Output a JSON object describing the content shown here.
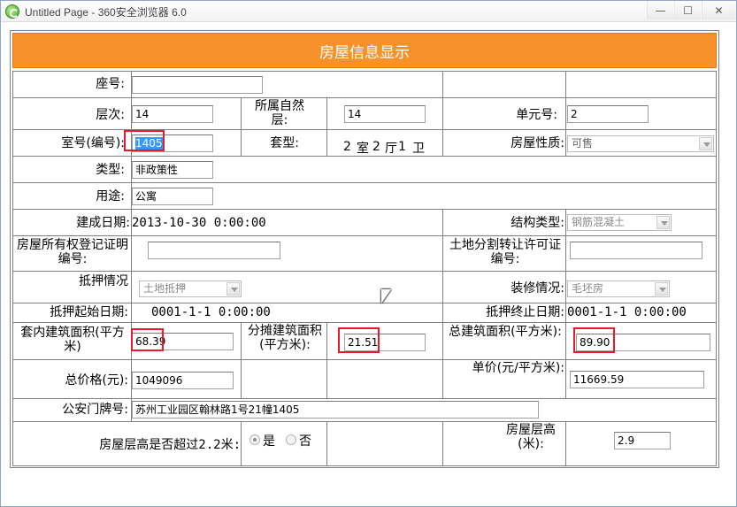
{
  "window": {
    "title": "Untitled Page - 360安全浏览器 6.0",
    "minimize": "—",
    "maximize": "☐",
    "close": "✕"
  },
  "header": {
    "title": "房屋信息显示"
  },
  "form": {
    "seat_no": {
      "label": "座号:",
      "value": ""
    },
    "floor": {
      "label": "层次:",
      "value": "14"
    },
    "natural_floor": {
      "label": "所属自然层:",
      "value": "14"
    },
    "unit_no": {
      "label": "单元号:",
      "value": "2"
    },
    "room_no": {
      "label": "室号(编号):",
      "value": "1405"
    },
    "layout": {
      "label": "套型:",
      "rooms": "2",
      "room_unit": "室",
      "halls": "2",
      "hall_unit": "厅",
      "baths": "1",
      "bath_unit": "卫"
    },
    "property_nature": {
      "label": "房屋性质:",
      "value": "可售"
    },
    "type": {
      "label": "类型:",
      "value": "非政策性"
    },
    "usage": {
      "label": "用途:",
      "value": "公寓"
    },
    "build_date": {
      "label": "建成日期:",
      "value": "2013-10-30 0:00:00"
    },
    "structure": {
      "label": "结构类型:",
      "value": "钢筋混凝土"
    },
    "ownership_cert": {
      "label": "房屋所有权登记证明编号:",
      "value": ""
    },
    "land_permit": {
      "label": "土地分割转让许可证编号:",
      "value": ""
    },
    "mortgage": {
      "label": "抵押情况",
      "value": "土地抵押"
    },
    "decoration": {
      "label": "装修情况:",
      "value": "毛坯房"
    },
    "mortgage_start": {
      "label": "抵押起始日期:",
      "value": "0001-1-1 0:00:00"
    },
    "mortgage_end": {
      "label": "抵押终止日期:",
      "value": "0001-1-1 0:00:00"
    },
    "inner_area": {
      "label": "套内建筑面积(平方米)",
      "value": "68.39"
    },
    "shared_area": {
      "label": "分摊建筑面积(平方米):",
      "value": "21.51"
    },
    "total_area": {
      "label": "总建筑面积(平方米):",
      "value": "89.90"
    },
    "total_price": {
      "label": "总价格(元):",
      "value": "1049096"
    },
    "unit_price": {
      "label": "单价(元/平方米):",
      "value": "11669.59"
    },
    "address": {
      "label": "公安门牌号:",
      "value": "苏州工业园区翰林路1号21幢1405"
    },
    "height_over": {
      "label": "房屋层高是否超过2.2米:",
      "yes": "是",
      "no": "否",
      "selected": "是"
    },
    "floor_height": {
      "label": "房屋层高(米):",
      "value": "2.9"
    }
  },
  "colors": {
    "header_bg": "#f7922b",
    "highlight": "#e8192c",
    "selection": "#3399ff"
  }
}
